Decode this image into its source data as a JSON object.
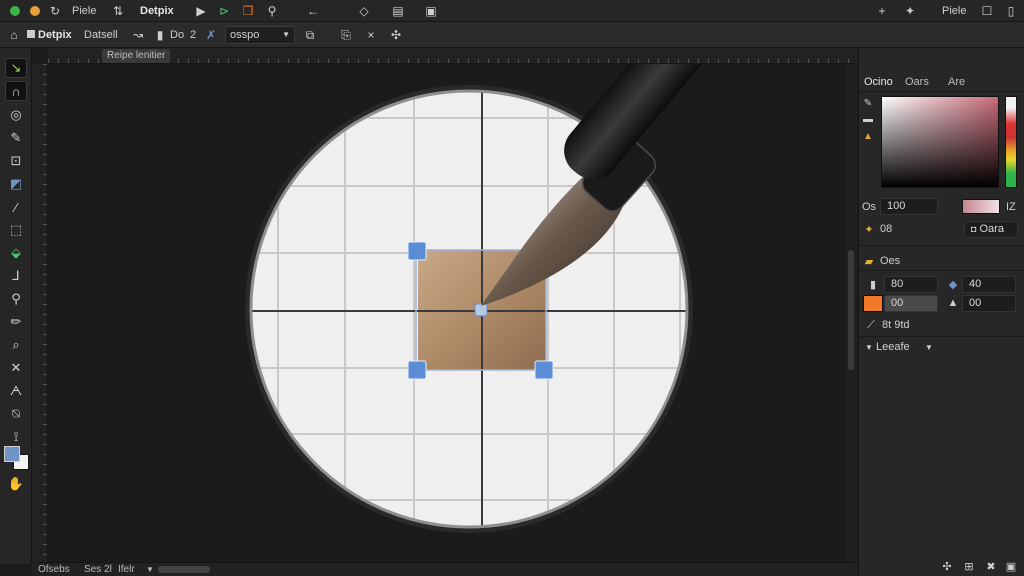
{
  "topbar": {
    "menu_file": "Piele",
    "app_name": "Detpix",
    "right_label": "Piele"
  },
  "optbar": {
    "doc_tab": "Detpix",
    "doc_sub": "Datsell",
    "do_label": "Do",
    "do_value": "2",
    "mode_value": "osspo"
  },
  "ruler": {
    "tooltip": "Reipe lenitier"
  },
  "right_panel": {
    "tabs": [
      "Ocino",
      "Oars",
      "Are"
    ],
    "opacity_label": "Os",
    "opacity_value": "100",
    "color_hex": "IZ",
    "brush_value": "08",
    "brush_mode": "Oara",
    "section_title": "Oes",
    "field_a": "80",
    "field_b": "40",
    "field_c": "00",
    "field_d": "00",
    "flow_label": "8t 9td",
    "layers_title": "Leeafe"
  },
  "statusbar": {
    "item1": "Ofsebs",
    "item2": "Ses 2l",
    "item3": "Ifelr"
  },
  "colors": {
    "accent": "#f07a2a",
    "handle": "#5b8cd6",
    "foreground": "#6f95c8",
    "background": "#f2f2f2"
  }
}
